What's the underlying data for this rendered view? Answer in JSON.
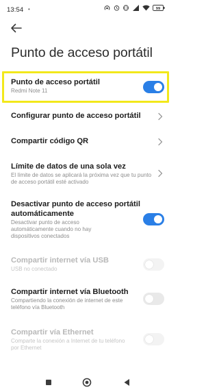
{
  "status_bar": {
    "time": "13:54",
    "dot": "•",
    "battery": "99",
    "icons": [
      "hotspot-icon",
      "alarm-icon",
      "vibrate-icon",
      "signal-icon",
      "wifi-icon",
      "battery-icon"
    ]
  },
  "header": {
    "back_icon": "back-arrow-icon",
    "title": "Punto de acceso portátil"
  },
  "settings": [
    {
      "key": "hotspot",
      "title": "Punto de acceso portátil",
      "subtitle": "Redmi Note 11",
      "control": "toggle",
      "state": "on",
      "enabled": true,
      "highlighted": true
    },
    {
      "key": "configure",
      "title": "Configurar punto de acceso portátil",
      "subtitle": "",
      "control": "chevron",
      "enabled": true
    },
    {
      "key": "qr",
      "title": "Compartir código QR",
      "subtitle": "",
      "control": "chevron",
      "enabled": true
    },
    {
      "key": "data_limit",
      "title": "Límite de datos de una sola vez",
      "subtitle": "El límite de datos se aplicará la próxima vez que tu punto de acceso portátil esté activado",
      "control": "chevron",
      "enabled": true
    },
    {
      "key": "auto_off",
      "title_line1": "Desactivar punto de acceso portátil",
      "title_line2": "automáticamente",
      "subtitle": "Desactivar punto de acceso automáticamente cuando no hay dispositivos conectados",
      "control": "toggle",
      "state": "on",
      "enabled": true
    },
    {
      "key": "usb",
      "title": "Compartir internet vía USB",
      "subtitle": "USB no conectado",
      "control": "toggle",
      "state": "off",
      "enabled": false
    },
    {
      "key": "bluetooth",
      "title": "Compartir internet vía Bluetooth",
      "subtitle": "Compartiendo la conexión de internet de este teléfono vía Bluetooth",
      "control": "toggle",
      "state": "off",
      "enabled": true
    },
    {
      "key": "ethernet",
      "title": "Compartir vía Ethernet",
      "subtitle": "Comparte la conexión a Internet de tu teléfono por Ethernet",
      "control": "toggle",
      "state": "off",
      "enabled": false
    }
  ],
  "nav_bar": {
    "icons": [
      "recents-icon",
      "home-icon",
      "back-icon"
    ]
  },
  "colors": {
    "accent": "#2a7fe6",
    "highlight": "#f2e81b",
    "disabled_text": "#b8b8b8"
  }
}
